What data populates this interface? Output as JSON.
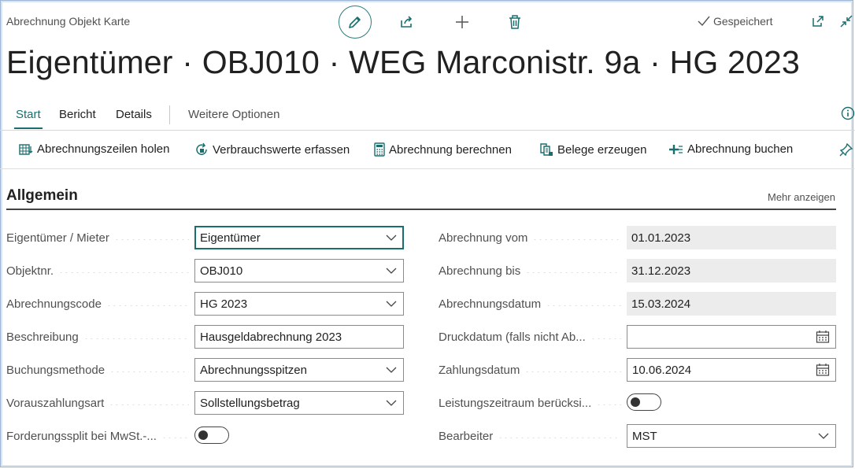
{
  "header": {
    "breadcrumb": "Abrechnung Objekt Karte",
    "saved_status": "Gespeichert",
    "title": "Eigentümer · OBJ010 · WEG Marconistr. 9a · HG 2023",
    "actions": [
      "pencil-icon",
      "share-icon",
      "plus-icon",
      "trash-icon"
    ]
  },
  "tabs": [
    {
      "label": "Start",
      "active": true
    },
    {
      "label": "Bericht"
    },
    {
      "label": "Details"
    },
    {
      "label": "Weitere Optionen"
    }
  ],
  "actions": [
    {
      "label": "Abrechnungszeilen holen",
      "icon": "fetch-lines-icon"
    },
    {
      "label": "Verbrauchswerte erfassen",
      "icon": "refresh-icon"
    },
    {
      "label": "Abrechnung berechnen",
      "icon": "calculator-icon"
    },
    {
      "label": "Belege erzeugen",
      "icon": "documents-icon"
    },
    {
      "label": "Abrechnung buchen",
      "icon": "post-icon"
    }
  ],
  "section": {
    "title": "Allgemein",
    "more": "Mehr anzeigen"
  },
  "fields_left": [
    {
      "label": "Eigentümer / Mieter",
      "value": "Eigentümer",
      "type": "select"
    },
    {
      "label": "Objektnr.",
      "value": "OBJ010",
      "type": "select"
    },
    {
      "label": "Abrechnungscode",
      "value": "HG 2023",
      "type": "select"
    },
    {
      "label": "Beschreibung",
      "value": "Hausgeldabrechnung 2023",
      "type": "text"
    },
    {
      "label": "Buchungsmethode",
      "value": "Abrechnungsspitzen",
      "type": "select"
    },
    {
      "label": "Vorauszahlungsart",
      "value": "Sollstellungsbetrag",
      "type": "select"
    },
    {
      "label": "Forderungssplit bei MwSt.-...",
      "value": "off",
      "type": "toggle"
    }
  ],
  "fields_right": [
    {
      "label": "Abrechnung vom",
      "value": "01.01.2023",
      "type": "readonly"
    },
    {
      "label": "Abrechnung bis",
      "value": "31.12.2023",
      "type": "readonly"
    },
    {
      "label": "Abrechnungsdatum",
      "value": "15.03.2024",
      "type": "readonly"
    },
    {
      "label": "Druckdatum (falls nicht Ab...",
      "value": "",
      "type": "date"
    },
    {
      "label": "Zahlungsdatum",
      "value": "10.06.2024",
      "type": "date"
    },
    {
      "label": "Leistungszeitraum berücksi...",
      "value": "off",
      "type": "toggle"
    },
    {
      "label": "Bearbeiter",
      "value": "MST",
      "type": "select"
    }
  ],
  "colors": {
    "accent": "#1a6e6e",
    "readonly_bg": "#ececec"
  }
}
